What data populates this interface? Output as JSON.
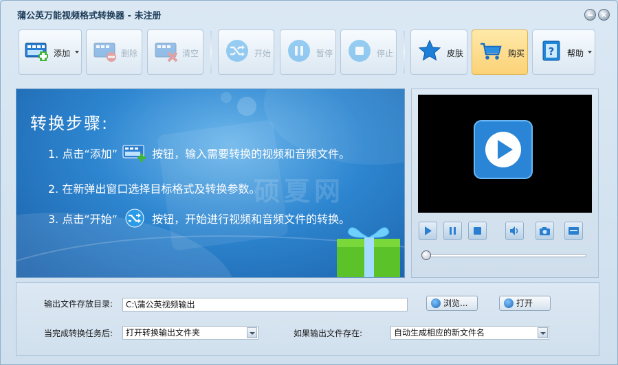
{
  "window": {
    "title": "蒲公英万能视频格式转换器 - 未注册"
  },
  "toolbar": {
    "add": "添加",
    "delete": "删除",
    "clear": "清空",
    "start": "开始",
    "pause": "暂停",
    "stop": "停止",
    "skin": "皮肤",
    "buy": "购买",
    "help": "帮助"
  },
  "banner": {
    "heading": "转换步骤:",
    "step1_prefix": "1. 点击“添加”",
    "step1_suffix": "按钮，输入需要转换的视频和音频文件。",
    "step2": "2. 在新弹出窗口选择目标格式及转换参数。",
    "step3_prefix": "3. 点击“开始”",
    "step3_suffix": "按钮，开始进行视频和音频文件的转换。",
    "watermark": "硕夏网"
  },
  "player": {
    "progress": 0
  },
  "settings": {
    "output_dir_label": "输出文件存放目录:",
    "output_dir_value": "C:\\蒲公英视频输出",
    "browse": "浏览...",
    "open": "打开",
    "after_done_label": "当完成转换任务后:",
    "after_done_value": "打开转换输出文件夹",
    "if_exists_label": "如果输出文件存在:",
    "if_exists_value": "自动生成相应的新文件名"
  },
  "colors": {
    "accent": "#1f7fd6",
    "buy_bg": "#fbd277"
  }
}
